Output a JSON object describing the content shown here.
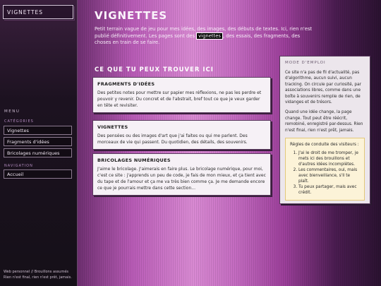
{
  "sidebar": {
    "brand": "VIGNETTES",
    "menu_heading": "MENU",
    "categories_heading": "CATÉGORIES",
    "categories": [
      "Vignettes",
      "Fragments d'idées",
      "Bricolages numériques"
    ],
    "navigation_heading": "NAVIGATION",
    "navigation": [
      "Accueil"
    ],
    "footer_line1": "Web personnel // Brouillons assumés",
    "footer_line2": "Rien n'est final, rien n'est prêt, jamais."
  },
  "main": {
    "title": "VIGNETTES",
    "intro_before": "Petit terrain vague de jeu pour mes idées, des images, des débuts de textes. Ici, rien n'est publié définitivement. Les pages sont des ",
    "intro_highlight": "vignettes",
    "intro_after": ", des essais, des fragments, des choses en train de se faire.",
    "section_title": "CE QUE TU PEUX TROUVER ICI",
    "cards": [
      {
        "title": "FRAGMENTS D'IDÉES",
        "text": "Des petites notes pour mettre sur papier mes réflexions, ne pas les perdre et pouvoir y revenir. Du concret et de l'abstrait, bref tout ce que je veux garder en tête et revisiter."
      },
      {
        "title": "VIGNETTES",
        "text": "Des pensées ou des images d'art que j'ai faites ou qui me parlent. Des morceaux de vie qui passent. Du quotidien, des détails, des souvenirs."
      },
      {
        "title": "BRICOLAGES NUMÉRIQUES",
        "text": "J'aime le bricolage. J'aimerais en faire plus. Le bricolage numérique, pour moi, c'est ce site : j'apprends un peu de code, je fais de mon mieux, et ça tient avec du tape et de l'amour et ça me va très bien comme ça. Je me demande encore ce que je pourrais mettre dans cette section..."
      }
    ]
  },
  "panel": {
    "title": "MODE D'EMPLOI",
    "para1": "Ce site n'a pas de fil d'actualité, pas d'algorithme, aucun suivi, aucun tracking. On circule par curiosité, par associations libres, comme dans une boîte à souvenirs remplie de rien, de vidanges et de trésors.",
    "para2": "Quand une idée change, la page change. Tout peut être réécrit, remobiné, enregistré par-dessus. Rien n'est final, rien n'est prêt, jamais.",
    "rules_title": "Règles de conduite des visiteurs :",
    "rules": [
      "J'ai le droit de me tromper, je mets ici des brouillons et d'autres idées incomplètes.",
      "Les commentaires, oui, mais avec bienveillance, s'il te plaît.",
      "Tu peux partager, mais avec crédit."
    ]
  }
}
